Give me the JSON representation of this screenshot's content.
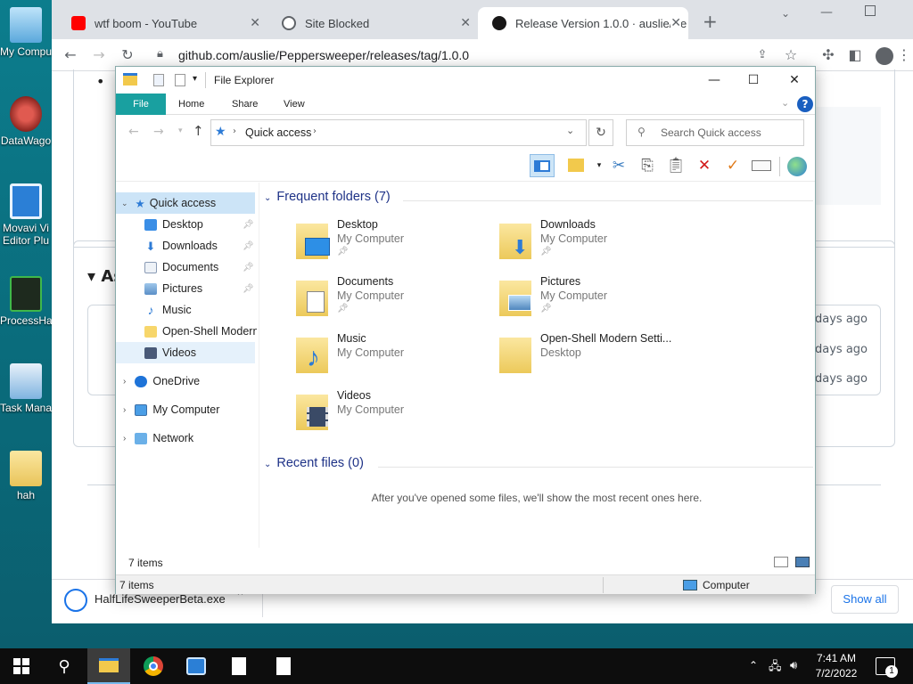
{
  "desktop": {
    "icons": [
      {
        "label": "My Compu",
        "icon": "computer-icon",
        "color": "#9ed0f0"
      },
      {
        "label": "DataWago",
        "icon": "datawagon-icon",
        "color": "#c0403a"
      },
      {
        "label": "Movavi Vi",
        "label2": "Editor Plu",
        "icon": "movavi-icon",
        "color": "#2b7fd6"
      },
      {
        "label": "ProcessHa",
        "icon": "processhacker-icon",
        "color": "#2f8a3a"
      },
      {
        "label": "Task Mana",
        "icon": "taskmanager-icon",
        "color": "#3a8fd0"
      },
      {
        "label": "hah",
        "icon": "folder-icon",
        "color": "#f3d67a"
      }
    ]
  },
  "chrome": {
    "tabs": [
      {
        "title": "wtf boom - YouTube",
        "icon": "youtube-icon",
        "color": "#ff0000"
      },
      {
        "title": "Site Blocked",
        "icon": "globe-icon",
        "color": "#5f6368"
      },
      {
        "title": "Release Version 1.0.0 · auslie/Pe",
        "icon": "github-icon",
        "color": "#181717"
      }
    ],
    "url": "github.com/auslie/Peppersweeper/releases/tag/1.0.0",
    "new_tab": "+",
    "page": {
      "bullet": "•",
      "assets_heading": "As",
      "rows_time": [
        "days ago",
        "days ago",
        "days ago"
      ]
    },
    "download": {
      "filename": "HalfLifeSweeperBeta.exe",
      "show_all": "Show all"
    }
  },
  "explorer": {
    "title": "File Explorer",
    "ribbon": [
      "File",
      "Home",
      "Share",
      "View"
    ],
    "address": "Quick access",
    "search_placeholder": "Search Quick access",
    "nav": {
      "quick_access": "Quick access",
      "pinned": [
        "Desktop",
        "Downloads",
        "Documents",
        "Pictures"
      ],
      "others": [
        "Music",
        "Open-Shell Modern",
        "Videos"
      ],
      "roots": [
        "OneDrive",
        "My Computer",
        "Network"
      ]
    },
    "frequent_header": "Frequent folders (7)",
    "folders": [
      {
        "name": "Desktop",
        "sub": "My Computer",
        "pinned": true,
        "icon": "desktop-folder-icon"
      },
      {
        "name": "Downloads",
        "sub": "My Computer",
        "pinned": true,
        "icon": "downloads-folder-icon"
      },
      {
        "name": "Documents",
        "sub": "My Computer",
        "pinned": true,
        "icon": "documents-folder-icon"
      },
      {
        "name": "Pictures",
        "sub": "My Computer",
        "pinned": true,
        "icon": "pictures-folder-icon"
      },
      {
        "name": "Music",
        "sub": "My Computer",
        "pinned": false,
        "icon": "music-folder-icon"
      },
      {
        "name": "Open-Shell Modern Setti...",
        "sub": "Desktop",
        "pinned": false,
        "icon": "folder-icon"
      },
      {
        "name": "Videos",
        "sub": "My Computer",
        "pinned": false,
        "icon": "videos-folder-icon"
      }
    ],
    "recent_header": "Recent files (0)",
    "recent_empty": "After you've opened some files, we'll show the most recent ones here.",
    "status_items": "7 items",
    "status_items2": "7 items",
    "status_location": "Computer"
  },
  "taskbar": {
    "time": "7:41 AM",
    "date": "7/2/2022",
    "notif_count": "1"
  }
}
